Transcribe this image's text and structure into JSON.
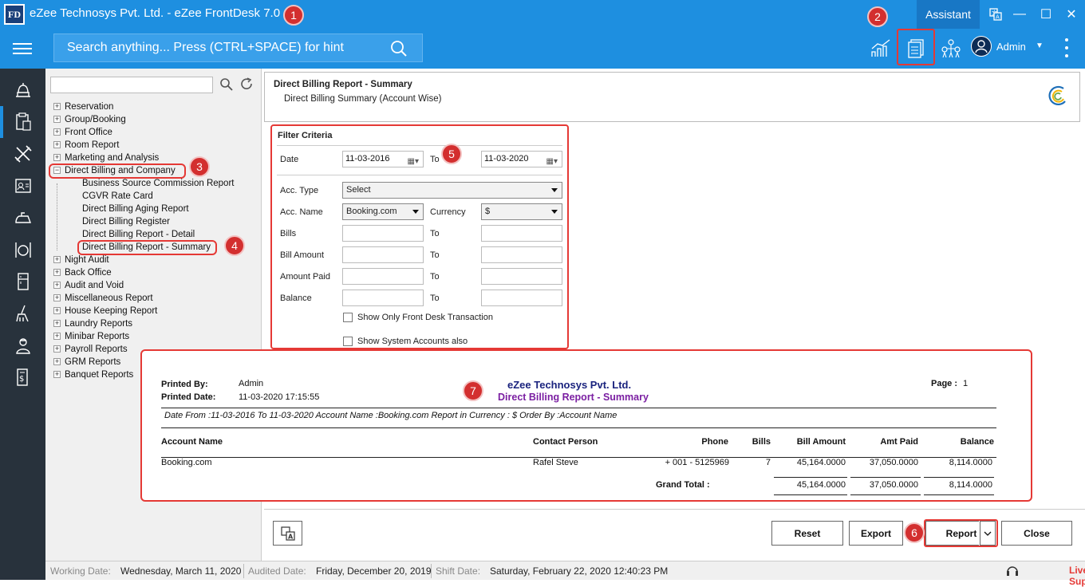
{
  "window": {
    "app_logo": "FD",
    "title": "eZee Technosys Pvt. Ltd. - eZee FrontDesk 7.0",
    "assistant_label": "Assistant",
    "controls": {
      "minimize": "—",
      "maximize": "☐",
      "close": "✕"
    }
  },
  "toolbar": {
    "search_placeholder": "Search anything... Press (CTRL+SPACE) for hint",
    "user_name": "Admin",
    "icons": [
      "chart-icon",
      "reports-icon",
      "network-icon",
      "user-icon"
    ]
  },
  "rail": {
    "icons": [
      "front-desk-icon",
      "reports-icon",
      "tools-icon",
      "id-card-icon",
      "housekeeping-icon",
      "restaurant-icon",
      "minibar-icon",
      "cleaning-icon",
      "staff-icon",
      "bill-icon"
    ]
  },
  "tree": {
    "nodes": [
      {
        "label": "Reservation",
        "expanded": false
      },
      {
        "label": "Group/Booking",
        "expanded": false
      },
      {
        "label": "Front Office",
        "expanded": false
      },
      {
        "label": "Room Report",
        "expanded": false
      },
      {
        "label": "Marketing and Analysis",
        "expanded": false
      },
      {
        "label": "Direct Billing and Company",
        "expanded": true
      },
      {
        "label": "Night Audit",
        "expanded": false
      },
      {
        "label": "Back Office",
        "expanded": false
      },
      {
        "label": "Audit and Void",
        "expanded": false
      },
      {
        "label": "Miscellaneous Report",
        "expanded": false
      },
      {
        "label": "House Keeping Report",
        "expanded": false
      },
      {
        "label": "Laundry Reports",
        "expanded": false
      },
      {
        "label": "Minibar Reports",
        "expanded": false
      },
      {
        "label": "Payroll Reports",
        "expanded": false
      },
      {
        "label": "GRM Reports",
        "expanded": false
      },
      {
        "label": "Banquet Reports",
        "expanded": false
      }
    ],
    "children": [
      "Business Source Commission Report",
      "CGVR Rate Card",
      "Direct Billing Aging Report",
      "Direct Billing Register",
      "Direct Billing Report - Detail",
      "Direct Billing Report - Summary"
    ],
    "expand_symbol": "+",
    "collapse_symbol": "−"
  },
  "badges": [
    "1",
    "2",
    "3",
    "4",
    "5",
    "6",
    "7"
  ],
  "report": {
    "title": "Direct Billing Report - Summary",
    "subtitle": "Direct Billing Summary (Account Wise)"
  },
  "filter": {
    "title": "Filter Criteria",
    "date_label": "Date",
    "date_from": "11-03-2016",
    "to_label": "To",
    "date_to": "11-03-2020",
    "acc_type_label": "Acc. Type",
    "acc_type_value": "Select",
    "acc_name_label": "Acc. Name",
    "acc_name_value": "Booking.com",
    "currency_label": "Currency",
    "currency_value": "$",
    "bills_label": "Bills",
    "bill_amount_label": "Bill Amount",
    "amount_paid_label": "Amount Paid",
    "balance_label": "Balance",
    "show_front_desk": "Show Only Front Desk Transaction",
    "show_system_accounts": "Show System Accounts also"
  },
  "preview": {
    "printed_by_label": "Printed By:",
    "printed_by": "Admin",
    "printed_date_label": "Printed Date:",
    "printed_date": "11-03-2020 17:15:55",
    "company": "eZee Technosys Pvt. Ltd.",
    "report_name": "Direct Billing Report - Summary",
    "page_label": "Page :",
    "page_no": "1",
    "criteria": "Date From :11-03-2016  To  11-03-2020  Account Name :Booking.com  Report in Currency : $     Order By :Account Name",
    "columns": [
      "Account Name",
      "Contact Person",
      "Phone",
      "Bills",
      "Bill Amount",
      "Amt Paid",
      "Balance"
    ],
    "row": [
      "Booking.com",
      "Rafel Steve",
      "+ 001 - 5125969",
      "7",
      "45,164.0000",
      "37,050.0000",
      "8,114.0000"
    ],
    "grand_total_label": "Grand Total :",
    "grand_total": [
      "45,164.0000",
      "37,050.0000",
      "8,114.0000"
    ]
  },
  "buttons": {
    "reset": "Reset",
    "export": "Export",
    "report": "Report",
    "close": "Close"
  },
  "status": {
    "working_date_label": "Working Date:",
    "working_date": "Wednesday, March 11, 2020",
    "audited_date_label": "Audited Date:",
    "audited_date": "Friday, December 20, 2019",
    "shift_date_label": "Shift Date:",
    "shift_date": "Saturday, February 22, 2020 12:40:23 PM",
    "live_support": "Live Support"
  },
  "colors": {
    "brand_blue": "#1e8fe0",
    "rail_dark": "#28323c",
    "annotation_red": "#d32f2f",
    "preview_company": "#1a237e",
    "preview_report": "#7b1fa2"
  }
}
